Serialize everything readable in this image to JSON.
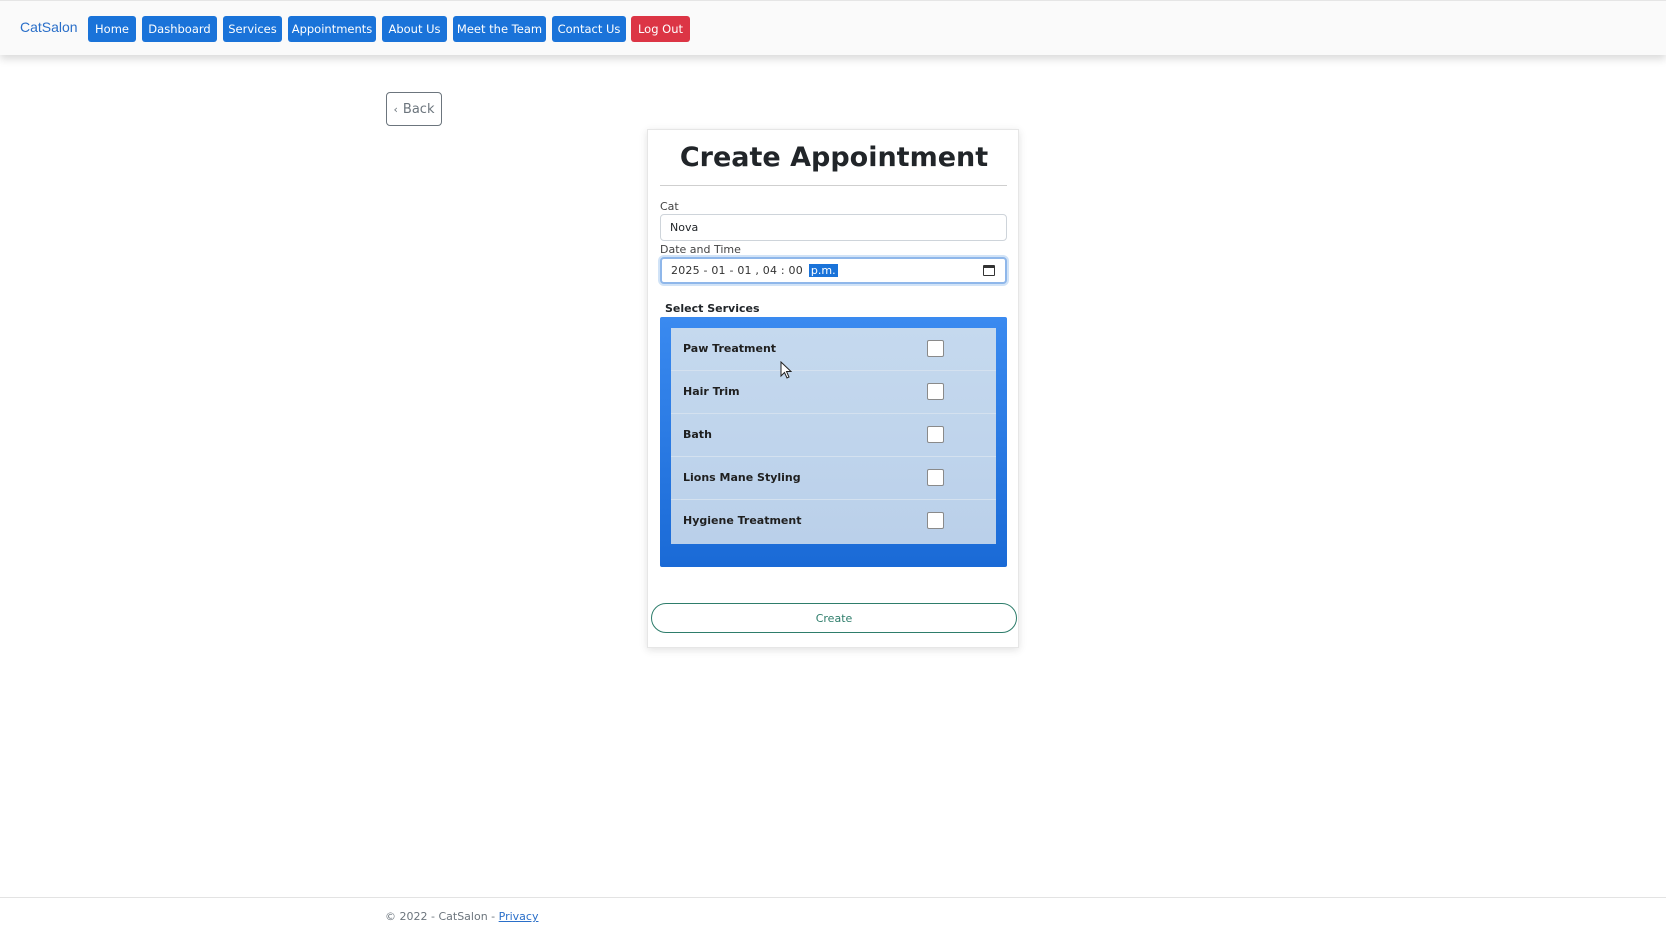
{
  "navbar": {
    "brand": "CatSalon",
    "items": [
      {
        "label": "Home"
      },
      {
        "label": "Dashboard"
      },
      {
        "label": "Services"
      },
      {
        "label": "Appointments"
      },
      {
        "label": "About Us"
      },
      {
        "label": "Meet the Team"
      },
      {
        "label": "Contact Us"
      },
      {
        "label": "Log Out",
        "style": "danger"
      }
    ]
  },
  "back_label": "Back",
  "form": {
    "title": "Create Appointment",
    "cat_label": "Cat",
    "cat_value": "Nova",
    "datetime_label": "Date and Time",
    "datetime_value": "2025 - 01 - 01 ,  04 : 00",
    "datetime_ampm": "p.m.",
    "services_heading": "Select Services",
    "services": [
      {
        "name": "Paw Treatment",
        "checked": false
      },
      {
        "name": "Hair Trim",
        "checked": false
      },
      {
        "name": "Bath",
        "checked": false
      },
      {
        "name": "Lions Mane Styling",
        "checked": false
      },
      {
        "name": "Hygiene Treatment",
        "checked": false
      }
    ],
    "submit_label": "Create"
  },
  "footer": {
    "text": "© 2022 - CatSalon - ",
    "privacy_link": "Privacy"
  },
  "colors": {
    "primary": "#1a73d9",
    "danger": "#dc3545",
    "success_outline": "#2e7d6b"
  }
}
